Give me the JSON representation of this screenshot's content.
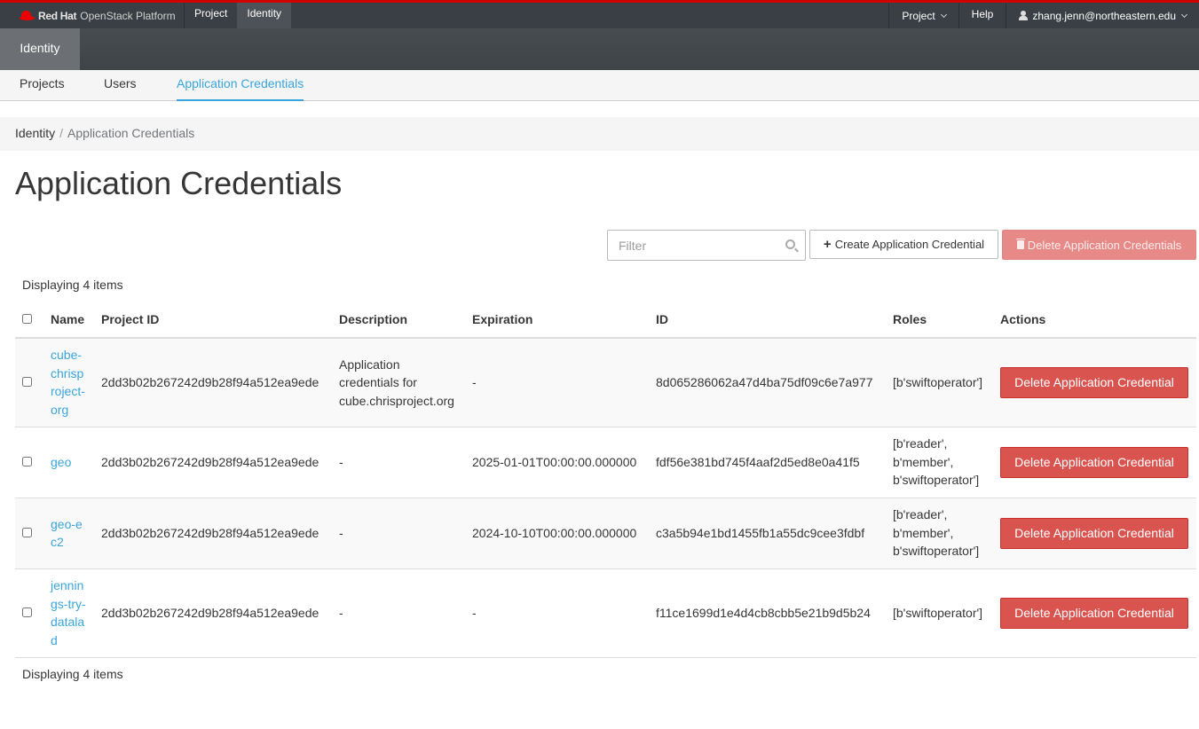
{
  "topbar": {
    "brand_bold": "Red Hat",
    "brand_rest": "OpenStack Platform",
    "nav": [
      {
        "label": "Project",
        "active": false
      },
      {
        "label": "Identity",
        "active": true
      }
    ],
    "project_menu": "Project",
    "help": "Help",
    "user": "zhang.jenn@northeastern.edu",
    "accent_color": "#cc0000"
  },
  "secondary_nav": {
    "active": "Identity"
  },
  "subnav": {
    "tabs": [
      {
        "label": "Projects",
        "active": false
      },
      {
        "label": "Users",
        "active": false
      },
      {
        "label": "Application Credentials",
        "active": true
      }
    ]
  },
  "breadcrumb": {
    "root": "Identity",
    "separator": "/",
    "current": "Application Credentials"
  },
  "page_title": "Application Credentials",
  "toolbar": {
    "filter_placeholder": "Filter",
    "filter_value": "",
    "create_label": "Create Application Credential",
    "delete_all_label": "Delete Application Credentials"
  },
  "table": {
    "count_label": "Displaying 4 items",
    "columns": [
      "Name",
      "Project ID",
      "Description",
      "Expiration",
      "ID",
      "Roles",
      "Actions"
    ],
    "rows": [
      {
        "name": "cube-chrisproject-org",
        "project_id": "2dd3b02b267242d9b28f94a512ea9ede",
        "description": "Application credentials for cube.chrisproject.org",
        "expiration": "-",
        "id": "8d065286062a47d4ba75df09c6e7a977",
        "roles": "[b'swiftoperator']",
        "action": "Delete Application Credential"
      },
      {
        "name": "geo",
        "project_id": "2dd3b02b267242d9b28f94a512ea9ede",
        "description": "-",
        "expiration": "2025-01-01T00:00:00.000000",
        "id": "fdf56e381bd745f4aaf2d5ed8e0a41f5",
        "roles": "[b'reader', b'member', b'swiftoperator']",
        "action": "Delete Application Credential"
      },
      {
        "name": "geo-ec2",
        "project_id": "2dd3b02b267242d9b28f94a512ea9ede",
        "description": "-",
        "expiration": "2024-10-10T00:00:00.000000",
        "id": "c3a5b94e1bd1455fb1a55dc9cee3fdbf",
        "roles": "[b'reader', b'member', b'swiftoperator']",
        "action": "Delete Application Credential"
      },
      {
        "name": "jennings-try-datalad",
        "project_id": "2dd3b02b267242d9b28f94a512ea9ede",
        "description": "-",
        "expiration": "-",
        "id": "f11ce1699d1e4d4cb8cbb5e21b9d5b24",
        "roles": "[b'swiftoperator']",
        "action": "Delete Application Credential"
      }
    ]
  }
}
